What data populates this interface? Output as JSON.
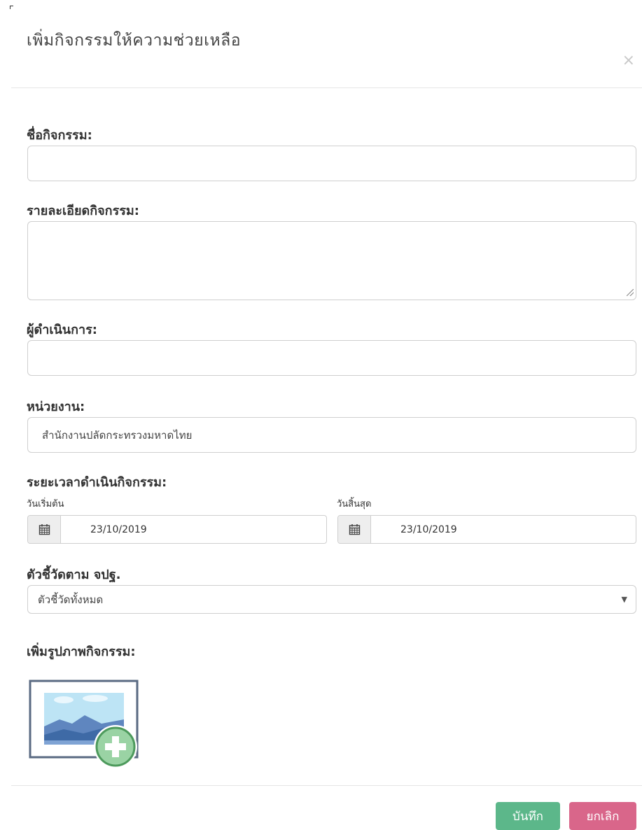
{
  "modal": {
    "title": "เพิ่มกิจกรรมให้ความช่วยเหลือ",
    "close_symbol": "×"
  },
  "form": {
    "activity_name": {
      "label": "ชื่อกิจกรรม:",
      "value": ""
    },
    "activity_detail": {
      "label": "รายละเอียดกิจกรรม:",
      "value": ""
    },
    "operator": {
      "label": "ผู้ดำเนินการ:",
      "value": ""
    },
    "agency": {
      "label": "หน่วยงาน:",
      "value": "สำนักงานปลัดกระทรวงมหาดไทย"
    },
    "period": {
      "label": "ระยะเวลาดำเนินกิจกรรม:",
      "start_label": "วันเริ่มต้น",
      "start_value": "23/10/2019",
      "end_label": "วันสิ้นสุด",
      "end_value": "23/10/2019",
      "icon": "calendar-icon"
    },
    "indicator": {
      "label": "ตัวชี้วัดตาม จปฐ.",
      "selected": "ตัวชี้วัดทั้งหมด"
    },
    "image": {
      "label": "เพิ่มรูปภาพกิจกรรม:",
      "icon": "add-image-icon"
    }
  },
  "buttons": {
    "save": "บันทึก",
    "cancel": "ยกเลิก"
  },
  "colors": {
    "save": "#5cb78a",
    "cancel": "#d9668a",
    "border": "#cfcfcf"
  }
}
